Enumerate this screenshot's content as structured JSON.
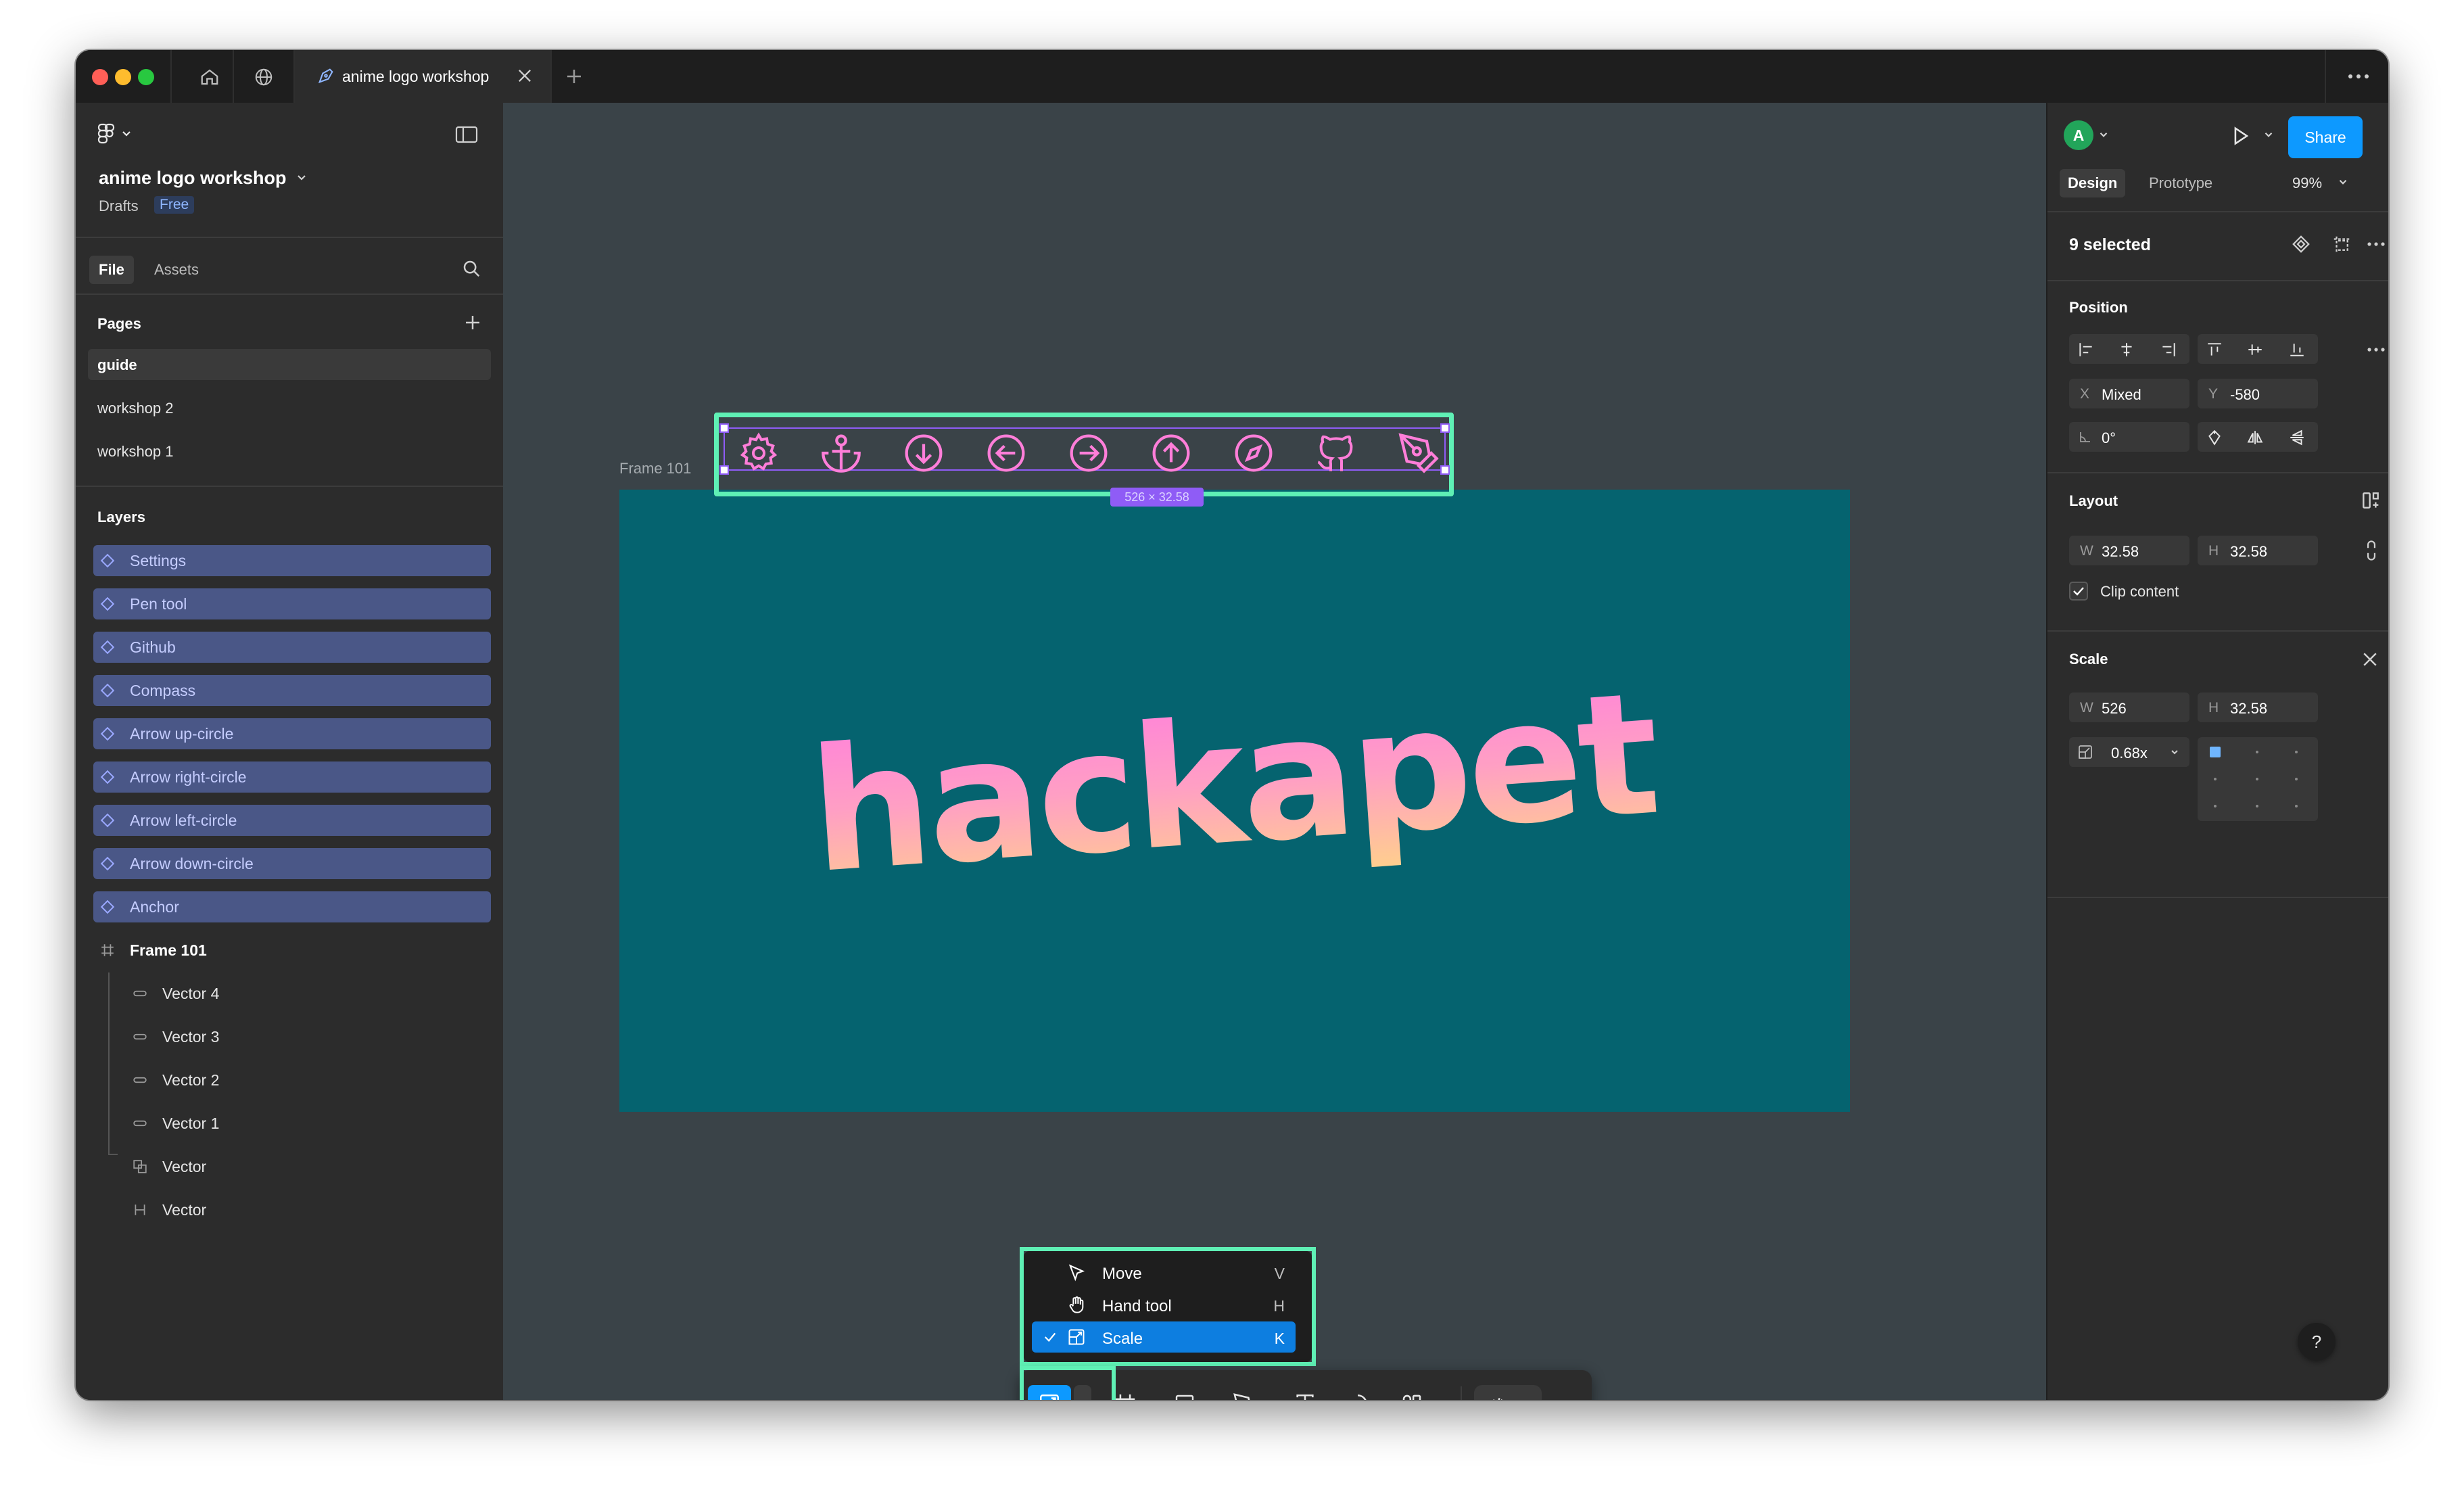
{
  "window": {
    "tab_title": "anime logo workshop",
    "traffic_lights": [
      "#ff5f57",
      "#febc2e",
      "#28c840"
    ]
  },
  "left_panel": {
    "file_name": "anime logo workshop",
    "location": "Drafts",
    "plan_badge": "Free",
    "tabs": [
      "File",
      "Assets"
    ],
    "pages_heading": "Pages",
    "pages": [
      "guide",
      "workshop 2",
      "workshop 1"
    ],
    "layers_heading": "Layers",
    "selected_layers": [
      "Settings",
      "Pen tool",
      "Github",
      "Compass",
      "Arrow up-circle",
      "Arrow right-circle",
      "Arrow left-circle",
      "Arrow down-circle",
      "Anchor"
    ],
    "frame_layer": "Frame 101",
    "child_layers": [
      "Vector 4",
      "Vector 3",
      "Vector 2",
      "Vector 1",
      "Vector",
      "Vector"
    ]
  },
  "canvas": {
    "frame_label": "Frame 101",
    "logo_text": "hackapet",
    "selection_size": "526 × 32.58",
    "icons": [
      "gear-icon",
      "anchor-icon",
      "arrow-down-circle-icon",
      "arrow-left-circle-icon",
      "arrow-right-circle-icon",
      "arrow-up-circle-icon",
      "compass-icon",
      "github-icon",
      "pen-tool-icon"
    ],
    "accent_color": "#5ff0b5",
    "icon_color": "#ff7ed9",
    "frame_color": "#05636f"
  },
  "menu": {
    "items": [
      {
        "label": "Move",
        "key": "V",
        "icon": "move-cursor-icon",
        "checked": false
      },
      {
        "label": "Hand tool",
        "key": "H",
        "icon": "hand-icon",
        "checked": false
      },
      {
        "label": "Scale",
        "key": "K",
        "icon": "scale-icon",
        "checked": true
      }
    ]
  },
  "right_panel": {
    "avatar_initial": "A",
    "share_label": "Share",
    "tabs": [
      "Design",
      "Prototype"
    ],
    "zoom": "99%",
    "selection_count": "9 selected",
    "position_heading": "Position",
    "x_label": "X",
    "x_value": "Mixed",
    "y_label": "Y",
    "y_value": "-580",
    "rotation_value": "0°",
    "layout_heading": "Layout",
    "w_label": "W",
    "w_value": "32.58",
    "h_label": "H",
    "h_value": "32.58",
    "clip_content": "Clip content",
    "scale_heading": "Scale",
    "scale_w_value": "526",
    "scale_h_value": "32.58",
    "scale_factor": "0.68x",
    "help_label": "?"
  }
}
